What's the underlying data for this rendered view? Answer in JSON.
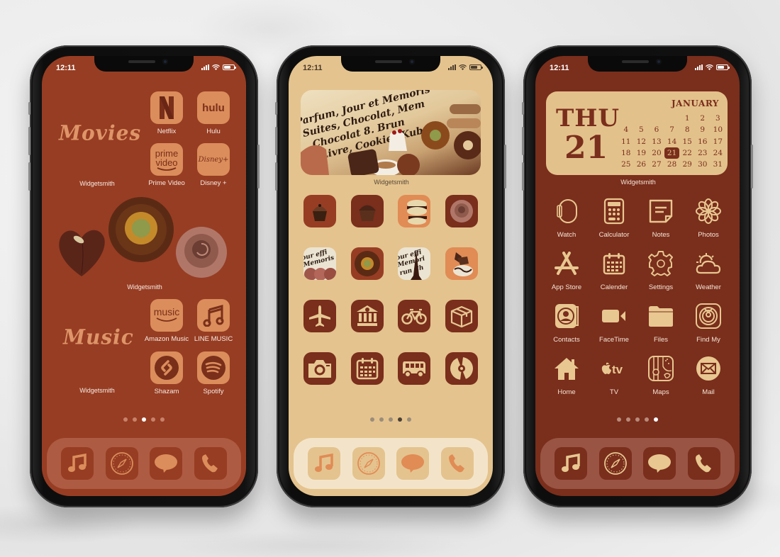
{
  "phones": [
    {
      "theme": "rust",
      "status": {
        "time": "12:11"
      },
      "widgets": [
        {
          "title": "Movies",
          "label": "Widgetsmith"
        },
        {
          "label": "Widgetsmith",
          "content": [
            "anthurium",
            "sunflower",
            "rose"
          ]
        },
        {
          "title": "Music",
          "label": "Widgetsmith"
        }
      ],
      "apps": [
        {
          "label": "Netflix",
          "icon": "netflix-icon",
          "glyph": "N"
        },
        {
          "label": "Hulu",
          "icon": "hulu-icon",
          "glyph": "hulu"
        },
        {
          "label": "Prime Video",
          "icon": "prime-video-icon",
          "glyph": "prime video"
        },
        {
          "label": "Disney +",
          "icon": "disney-plus-icon",
          "glyph": "Disney+"
        },
        {
          "label": "Amazon Music",
          "icon": "amazon-music-icon",
          "glyph": "music"
        },
        {
          "label": "LINE MUSIC",
          "icon": "music-note-icon",
          "glyph": "♫"
        },
        {
          "label": "Shazam",
          "icon": "shazam-icon",
          "glyph": "S"
        },
        {
          "label": "Spotify",
          "icon": "spotify-icon",
          "glyph": ""
        }
      ],
      "page_dots": {
        "count": 5,
        "active": 3
      },
      "dock": [
        "music-icon",
        "safari-icon",
        "messages-icon",
        "phone-icon"
      ],
      "colors": {
        "background": "#973d23",
        "tile": "#db8d5b",
        "accent": "#7a2f1a"
      }
    },
    {
      "theme": "tan",
      "status": {
        "time": "12:11"
      },
      "widgets": [
        {
          "label": "Widgetsmith",
          "content": "chocolate collage"
        }
      ],
      "apps": [
        {
          "icon": "cupcake-image"
        },
        {
          "icon": "chocolate-muffin-image"
        },
        {
          "icon": "macaron-image"
        },
        {
          "icon": "rose-image"
        },
        {
          "icon": "newspaper-cookies-image"
        },
        {
          "icon": "sunflower-image"
        },
        {
          "icon": "eiffel-tower-image"
        },
        {
          "icon": "chocolate-dessert-image"
        },
        {
          "icon": "airplane-icon"
        },
        {
          "icon": "bank-icon"
        },
        {
          "icon": "bicycle-icon"
        },
        {
          "icon": "package-icon"
        },
        {
          "icon": "camera-icon"
        },
        {
          "icon": "calendar-icon"
        },
        {
          "icon": "bus-icon"
        },
        {
          "icon": "disc-icon"
        }
      ],
      "page_dots": {
        "count": 5,
        "active": 4
      },
      "dock": [
        "music-icon",
        "safari-icon",
        "messages-icon",
        "phone-icon"
      ],
      "colors": {
        "background": "#e4c38e",
        "tile": "#7a2e1c",
        "accent": "#e18b55"
      }
    },
    {
      "theme": "maroon",
      "status": {
        "time": "12:11"
      },
      "widgets": [
        {
          "label": "Widgetsmith",
          "calendar": {
            "weekday": "THU",
            "day": "21",
            "month": "JANUARY",
            "leading_blanks": 4,
            "days": [
              "1",
              "2",
              "3",
              "4",
              "5",
              "6",
              "7",
              "8",
              "9",
              "10",
              "11",
              "12",
              "13",
              "14",
              "15",
              "16",
              "17",
              "18",
              "19",
              "20",
              "21",
              "22",
              "23",
              "24",
              "25",
              "26",
              "27",
              "28",
              "29",
              "30",
              "31"
            ],
            "today": "21"
          }
        }
      ],
      "apps": [
        {
          "label": "Watch",
          "icon": "watch-icon"
        },
        {
          "label": "Calculator",
          "icon": "calculator-icon"
        },
        {
          "label": "Notes",
          "icon": "notes-icon"
        },
        {
          "label": "Photos",
          "icon": "photos-icon"
        },
        {
          "label": "App Store",
          "icon": "app-store-icon"
        },
        {
          "label": "Calender",
          "icon": "calendar-icon"
        },
        {
          "label": "Settings",
          "icon": "gear-icon"
        },
        {
          "label": "Weather",
          "icon": "weather-icon"
        },
        {
          "label": "Contacts",
          "icon": "contacts-icon"
        },
        {
          "label": "FaceTime",
          "icon": "video-camera-icon"
        },
        {
          "label": "Files",
          "icon": "folder-icon"
        },
        {
          "label": "Find My",
          "icon": "find-my-icon"
        },
        {
          "label": "Home",
          "icon": "home-icon"
        },
        {
          "label": "TV",
          "icon": "apple-tv-icon",
          "glyph": "tv"
        },
        {
          "label": "Maps",
          "icon": "maps-icon"
        },
        {
          "label": "Mail",
          "icon": "mail-icon"
        }
      ],
      "page_dots": {
        "count": 5,
        "active": 5
      },
      "dock": [
        "music-icon",
        "safari-icon",
        "messages-icon",
        "phone-icon"
      ],
      "colors": {
        "background": "#7a2e1c",
        "icon": "#e8c790",
        "widget": "#e3c18b"
      }
    }
  ]
}
